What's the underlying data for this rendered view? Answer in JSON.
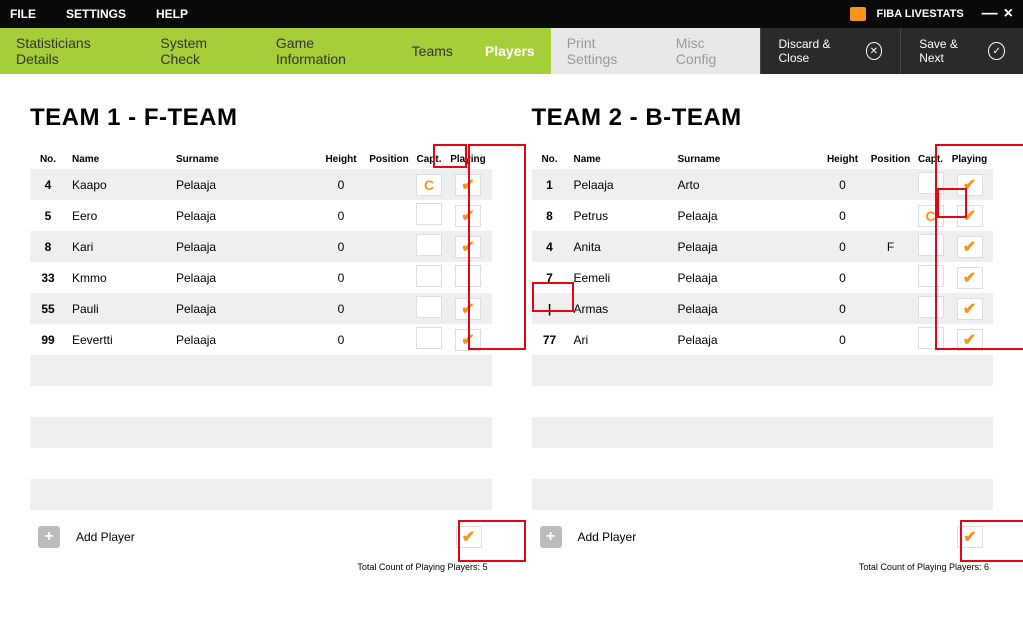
{
  "topmenu": {
    "file": "FILE",
    "settings": "SETTINGS",
    "help": "HELP"
  },
  "brand": "FIBA LIVESTATS",
  "tabs": {
    "stat": "Statisticians Details",
    "system": "System Check",
    "game": "Game Information",
    "teams": "Teams",
    "players": "Players",
    "print": "Print Settings",
    "misc": "Misc Config"
  },
  "actions": {
    "discard": "Discard & Close",
    "save": "Save & Next"
  },
  "headers": {
    "no": "No.",
    "name": "Name",
    "surname": "Surname",
    "height": "Height",
    "position": "Position",
    "capt": "Capt.",
    "playing": "Playing"
  },
  "team1": {
    "title": "TEAM 1 - F-TEAM",
    "players": [
      {
        "no": "4",
        "name": "Kaapo",
        "surname": "Pelaaja",
        "height": "0",
        "position": "",
        "capt": "C",
        "playing": true
      },
      {
        "no": "5",
        "name": "Eero",
        "surname": "Pelaaja",
        "height": "0",
        "position": "",
        "capt": "",
        "playing": true
      },
      {
        "no": "8",
        "name": "Kari",
        "surname": "Pelaaja",
        "height": "0",
        "position": "",
        "capt": "",
        "playing": true
      },
      {
        "no": "33",
        "name": "Kmmo",
        "surname": "Pelaaja",
        "height": "0",
        "position": "",
        "capt": "",
        "playing": false
      },
      {
        "no": "55",
        "name": "Pauli",
        "surname": "Pelaaja",
        "height": "0",
        "position": "",
        "capt": "",
        "playing": true
      },
      {
        "no": "99",
        "name": "Eevertti",
        "surname": "Pelaaja",
        "height": "0",
        "position": "",
        "capt": "",
        "playing": true
      }
    ],
    "add": "Add Player",
    "total": "Total Count of Playing Players: 5"
  },
  "team2": {
    "title": "TEAM 2 - B-TEAM",
    "players": [
      {
        "no": "1",
        "name": "Pelaaja",
        "surname": "Arto",
        "height": "0",
        "position": "",
        "capt": "",
        "playing": true
      },
      {
        "no": "8",
        "name": "Petrus",
        "surname": "Pelaaja",
        "height": "0",
        "position": "",
        "capt": "C",
        "playing": true
      },
      {
        "no": "4",
        "name": "Anita",
        "surname": "Pelaaja",
        "height": "0",
        "position": "F",
        "capt": "",
        "playing": true
      },
      {
        "no": "7",
        "name": "Eemeli",
        "surname": "Pelaaja",
        "height": "0",
        "position": "",
        "capt": "",
        "playing": true
      },
      {
        "no": "|",
        "name": "Armas",
        "surname": "Pelaaja",
        "height": "0",
        "position": "",
        "capt": "",
        "playing": true
      },
      {
        "no": "77",
        "name": "Ari",
        "surname": "Pelaaja",
        "height": "0",
        "position": "",
        "capt": "",
        "playing": true
      }
    ],
    "add": "Add Player",
    "total": "Total Count of Playing Players: 6"
  }
}
